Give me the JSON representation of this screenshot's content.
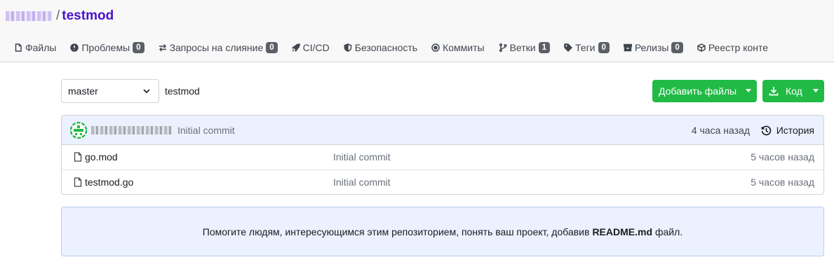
{
  "header": {
    "owner": "",
    "separator": "/",
    "repo_name": "testmod"
  },
  "tabs": [
    {
      "label": "Файлы",
      "icon": "file-icon"
    },
    {
      "label": "Проблемы",
      "icon": "issue-icon",
      "count": "0"
    },
    {
      "label": "Запросы на слияние",
      "icon": "pull-request-icon",
      "count": "0"
    },
    {
      "label": "CI/CD",
      "icon": "rocket-icon"
    },
    {
      "label": "Безопасность",
      "icon": "shield-icon"
    },
    {
      "label": "Коммиты",
      "icon": "commit-icon"
    },
    {
      "label": "Ветки",
      "icon": "branch-icon",
      "count": "1"
    },
    {
      "label": "Теги",
      "icon": "tag-icon",
      "count": "0"
    },
    {
      "label": "Релизы",
      "icon": "release-icon",
      "count": "0"
    },
    {
      "label": "Реестр конте",
      "icon": "package-icon"
    }
  ],
  "toolbar": {
    "branch": "master",
    "path": "testmod",
    "add_files_label": "Добавить файлы",
    "code_label": "Код"
  },
  "latest_commit": {
    "author": "",
    "message": "Initial commit",
    "time": "4 часа назад",
    "history_label": "История"
  },
  "files": [
    {
      "name": "go.mod",
      "commit": "Initial commit",
      "time": "5 часов назад"
    },
    {
      "name": "testmod.go",
      "commit": "Initial commit",
      "time": "5 часов назад"
    }
  ],
  "readme_note": {
    "before": "Помогите людям, интересующимся этим репозиторием, понять ваш проект, добавив",
    "file": "README.md",
    "after": "файл."
  },
  "colors": {
    "accent": "#4a13c9",
    "primary_green": "#21ba45",
    "info_bg": "#ebf1fe"
  }
}
